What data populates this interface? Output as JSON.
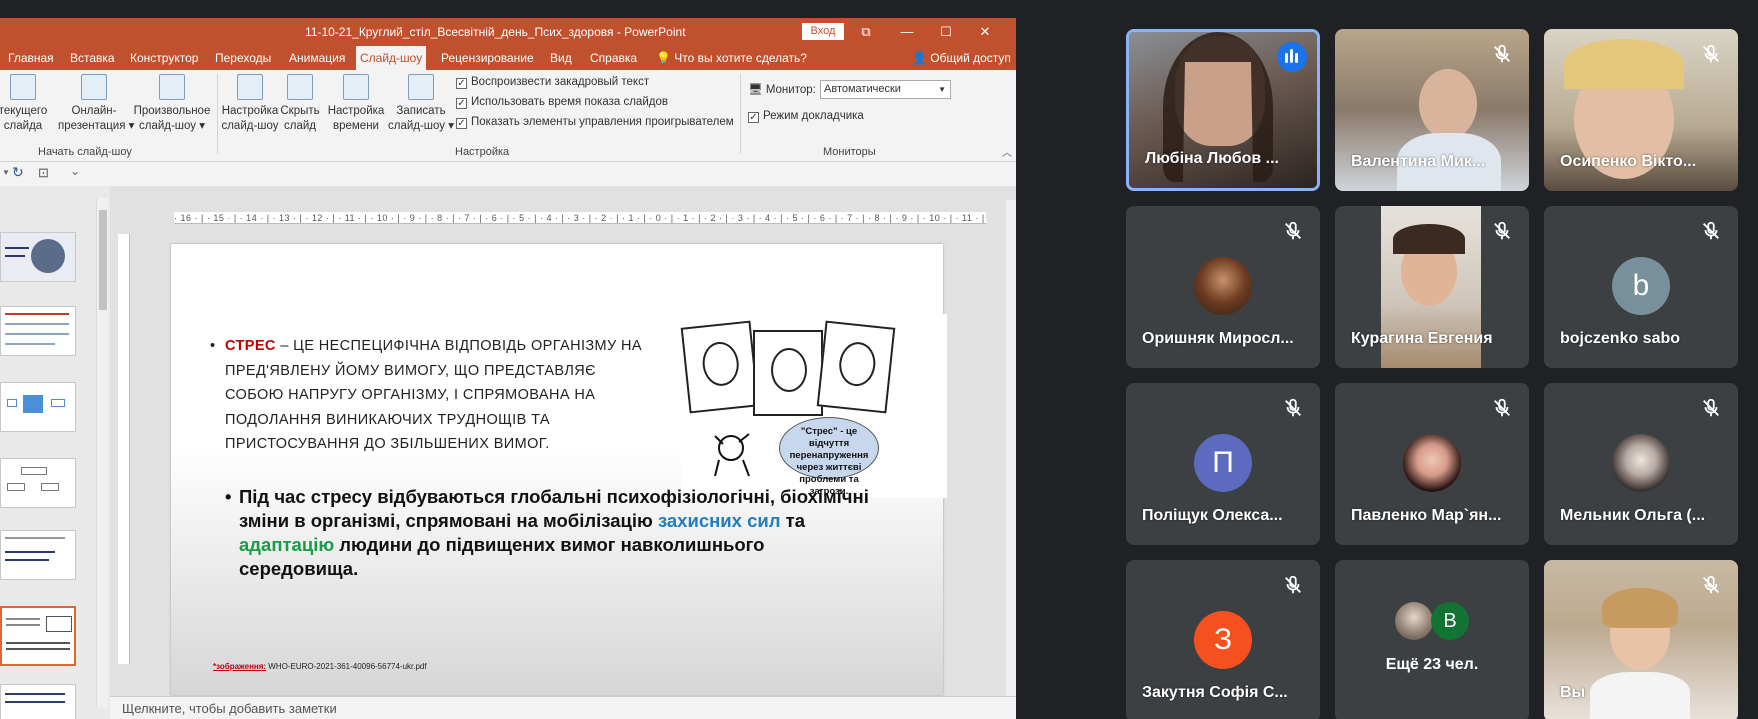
{
  "ppt": {
    "title": "11-10-21_Круглий_стіл_Всесвітній_день_Псих_здоровя  -  PowerPoint",
    "signin": "Вход",
    "tabs": [
      "Главная",
      "Вставка",
      "Конструктор",
      "Переходы",
      "Анимация",
      "Слайд-шоу",
      "Рецензирование",
      "Вид",
      "Справка",
      "Что вы хотите сделать?"
    ],
    "active_tab": "Слайд-шоу",
    "share": "Общий доступ",
    "ribbon": {
      "b1_l1": "текущего",
      "b1_l2": "слайда",
      "b2_l1": "Онлайн-",
      "b2_l2": "презентация ▾",
      "b3_l1": "Произвольное",
      "b3_l2": "слайд-шоу ▾",
      "group1": "Начать слайд-шоу",
      "b4_l1": "Настройка",
      "b4_l2": "слайд-шоу",
      "b5_l1": "Скрыть",
      "b5_l2": "слайд",
      "b6_l1": "Настройка",
      "b6_l2": "времени",
      "b7_l1": "Записать",
      "b7_l2": "слайд-шоу ▾",
      "check1": "Воспроизвести закадровый текст",
      "check2": "Использовать время показа слайдов",
      "check3": "Показать элементы управления проигрывателем",
      "group2": "Настройка",
      "monitor_label": "Монитор:",
      "monitor_value": "Автоматически",
      "presenter_view": "Режим докладчика",
      "group3": "Мониторы"
    },
    "ruler_text": "· 16 · | · 15 · | · 14 · | · 13 · | · 12 · | · 11 · | · 10 · | · 9 · | · 8 · | · 7 · | · 6 · | · 5 · | · 4 · | · 3 · | · 2 · | · 1 · | · 0 · | · 1 · | · 2 · | · 3 · | · 4 · | · 5 · | · 6 · | · 7 · | · 8 · | · 9 · | · 10 · | · 11 · | · 12 · | · 13 · | · 14 · | · 15 · | · 16 ·",
    "notes_placeholder": "Щелкните, чтобы добавить заметки"
  },
  "slide": {
    "p1_bold": "СТРЕС",
    "p1_rest": " – ЦЕ НЕСПЕЦИФІЧНА ВІДПОВІДЬ ОРГАНІЗМУ НА ПРЕД'ЯВЛЕНУ ЙОМУ ВИМОГУ, ЩО ПРЕДСТАВЛЯЄ СОБОЮ НАПРУГУ ОРГАНІЗМУ, І СПРЯМОВАНА НА ПОДОЛАННЯ ВИНИКАЮЧИХ ТРУДНОЩІВ ТА ПРИСТОСУВАННЯ ДО ЗБІЛЬШЕНИХ ВИМОГ.",
    "bubble": "\"Стрес\" - це відчуття перенапруження через життєві проблеми та загрози.",
    "p2_a": "Під час стресу відбуваються глобальні психофізіологічні, біохімічні зміни в організмі, спрямовані на мобілізацію ",
    "p2_blue": "захисних сил",
    "p2_b": " та ",
    "p2_green": "адаптацію",
    "p2_c": " людини до підвищених вимог навколишнього середовища.",
    "source_label": "*зображення:",
    "source_file": " WHO-EURO-2021-361-40096-56774-ukr.pdf"
  },
  "participants": [
    {
      "name": "Любіна Любов ...",
      "speaking": true
    },
    {
      "name": "Валентина Мик..."
    },
    {
      "name": "Осипенко Вікто..."
    },
    {
      "name": "Оришняк Миросл..."
    },
    {
      "name": "Курагина Евгения"
    },
    {
      "name": "bojczenko sabo",
      "initial": "b",
      "color": "#78909c"
    },
    {
      "name": "Поліщук Олекса...",
      "initial": "П",
      "color": "#5c6bc0"
    },
    {
      "name": "Павленко Мар`ян..."
    },
    {
      "name": "Мельник Ольга (..."
    },
    {
      "name": "Закутня Софія С...",
      "initial": "З",
      "color": "#f4511e"
    },
    {
      "name": "Ещё 23 чел.",
      "initial": "В",
      "color": "#137333"
    },
    {
      "name": "Вы"
    }
  ],
  "colors": {
    "accent": "#c1502e",
    "meet_bg": "#202124",
    "tile_bg": "#3c4043",
    "speaking_border": "#8ab4f8"
  }
}
